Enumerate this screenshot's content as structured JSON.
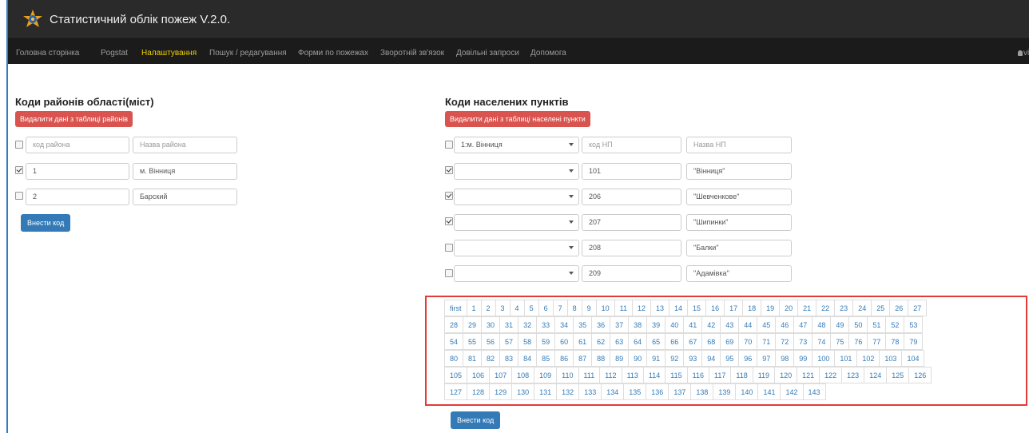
{
  "app": {
    "title": "Статистичний облік пожеж V.2.0."
  },
  "nav": {
    "items": [
      {
        "label": "Головна сторінка"
      },
      {
        "label": "Pogstat"
      },
      {
        "label": "Налаштування"
      },
      {
        "label": "Пошук / редагування"
      },
      {
        "label": "Форми по пожежах"
      },
      {
        "label": "Зворотній зв'язок"
      },
      {
        "label": "Довільні запроси"
      },
      {
        "label": "Допомога"
      }
    ],
    "active": "Налаштування",
    "user": "vinica"
  },
  "districts": {
    "title": "Коди районів області(міст)",
    "delete_label": "Видалити дані з таблиці районів",
    "code_placeholder": "код района",
    "name_placeholder": "Назва района",
    "rows": [
      {
        "checked": true,
        "code": "1",
        "name": "м. Вінниця"
      },
      {
        "checked": false,
        "code": "2",
        "name": "Барский"
      }
    ],
    "submit_label": "Внести код"
  },
  "settlements": {
    "title": "Коди населених пунктів",
    "delete_label": "Видалити дані з таблиці населені пункти",
    "filter_select": "1:м. Вінниця",
    "code_placeholder": "код НП",
    "name_placeholder": "Назва НП",
    "rows": [
      {
        "checked": true,
        "select": "",
        "code": "101",
        "name": "\"Вінниця\""
      },
      {
        "checked": true,
        "select": "",
        "code": "206",
        "name": "\"Шевченкове\""
      },
      {
        "checked": true,
        "select": "",
        "code": "207",
        "name": "\"Шипинки\""
      },
      {
        "checked": false,
        "select": "",
        "code": "208",
        "name": "\"Балки\""
      },
      {
        "checked": false,
        "select": "",
        "code": "209",
        "name": "\"Адамівка\""
      }
    ],
    "submit_label": "Внести код"
  },
  "pagination": {
    "first_label": "first",
    "rows": [
      [
        "first",
        "1",
        "2",
        "3",
        "4",
        "5",
        "6",
        "7",
        "8",
        "9",
        "10",
        "11",
        "12",
        "13",
        "14",
        "15",
        "16",
        "17",
        "18",
        "19",
        "20",
        "21",
        "22",
        "23",
        "24",
        "25",
        "26",
        "27"
      ],
      [
        "28",
        "29",
        "30",
        "31",
        "32",
        "33",
        "34",
        "35",
        "36",
        "37",
        "38",
        "39",
        "40",
        "41",
        "42",
        "43",
        "44",
        "45",
        "46",
        "47",
        "48",
        "49",
        "50",
        "51",
        "52",
        "53"
      ],
      [
        "54",
        "55",
        "56",
        "57",
        "58",
        "59",
        "60",
        "61",
        "62",
        "63",
        "64",
        "65",
        "66",
        "67",
        "68",
        "69",
        "70",
        "71",
        "72",
        "73",
        "74",
        "75",
        "76",
        "77",
        "78",
        "79"
      ],
      [
        "80",
        "81",
        "82",
        "83",
        "84",
        "85",
        "86",
        "87",
        "88",
        "89",
        "90",
        "91",
        "92",
        "93",
        "94",
        "95",
        "96",
        "97",
        "98",
        "99",
        "100",
        "101",
        "102",
        "103",
        "104"
      ],
      [
        "105",
        "106",
        "107",
        "108",
        "109",
        "110",
        "111",
        "112",
        "113",
        "114",
        "115",
        "116",
        "117",
        "118",
        "119",
        "120",
        "121",
        "122",
        "123",
        "124",
        "125",
        "126"
      ],
      [
        "127",
        "128",
        "129",
        "130",
        "131",
        "132",
        "133",
        "134",
        "135",
        "136",
        "137",
        "138",
        "139",
        "140",
        "141",
        "142",
        "143"
      ]
    ]
  },
  "colors": {
    "danger": "#d9534f",
    "primary": "#337ab7",
    "highlight_box": "#e33a3a",
    "nav_active": "#f0d000"
  }
}
